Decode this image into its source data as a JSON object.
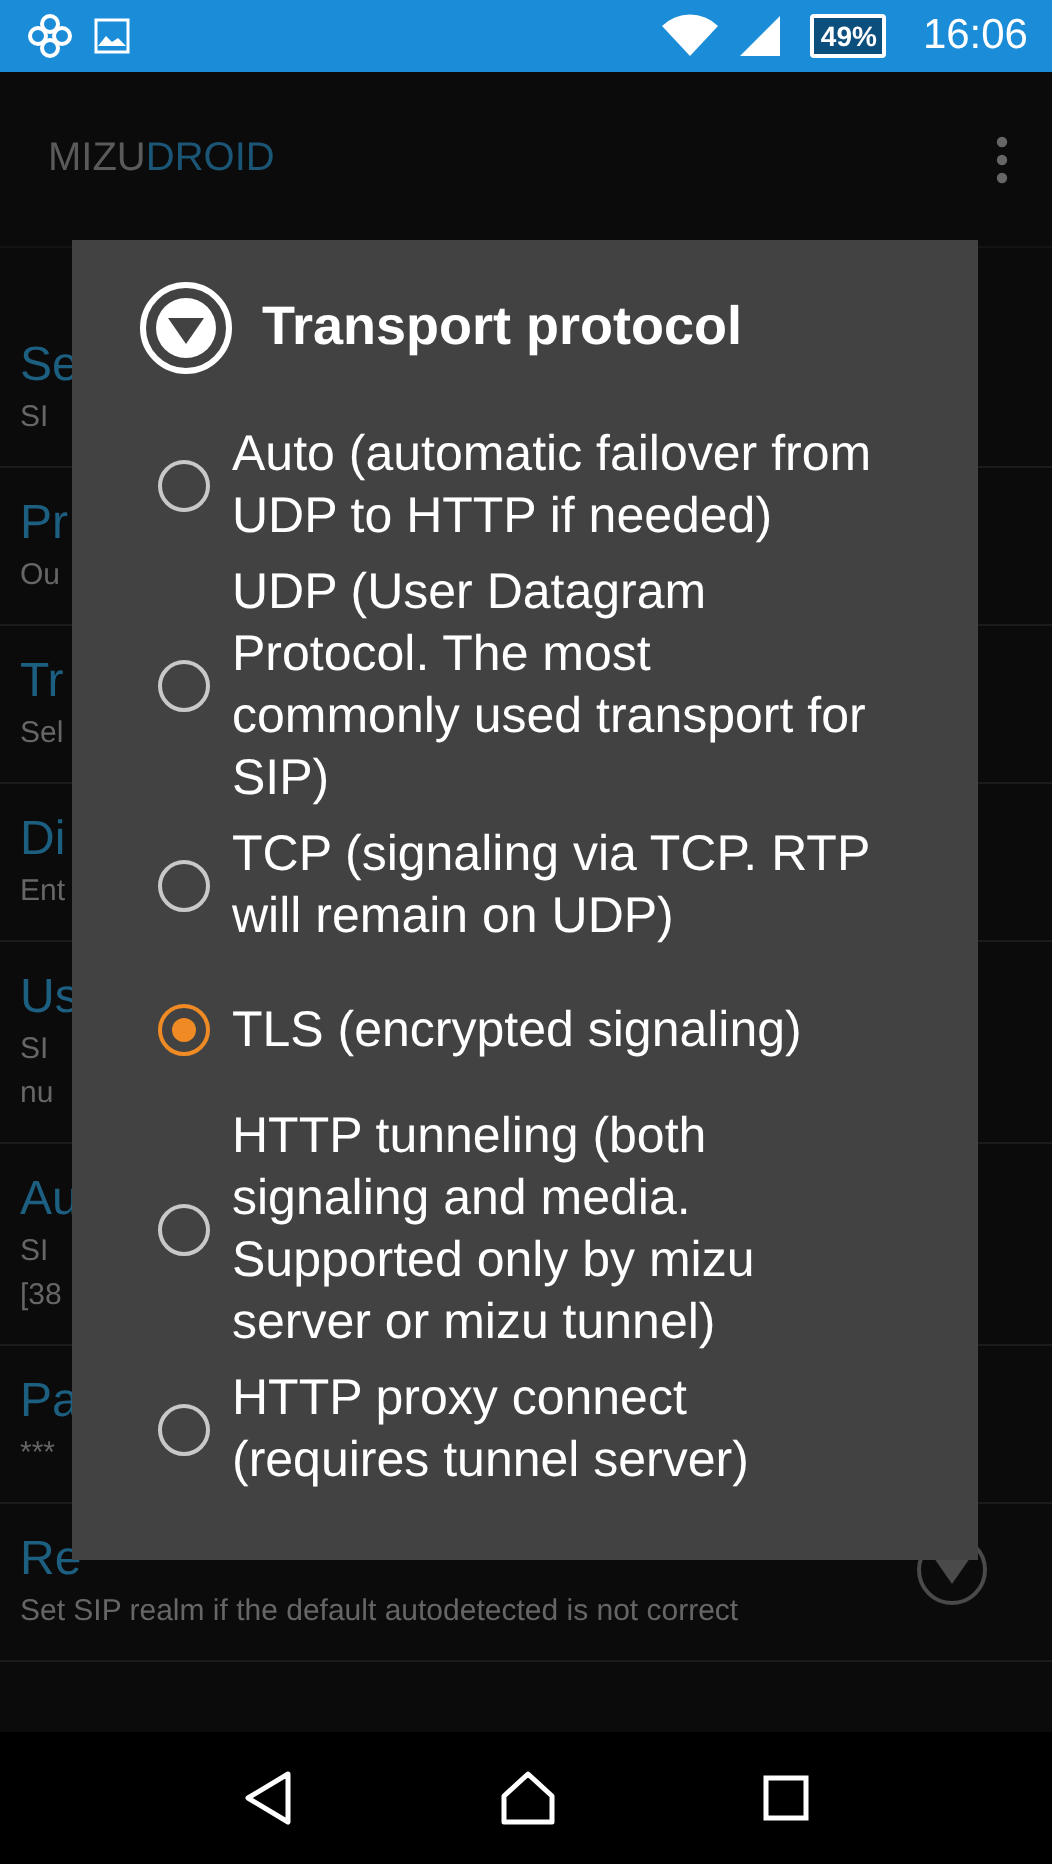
{
  "status_bar": {
    "battery": "49%",
    "time": "16:06"
  },
  "app_bar": {
    "title_part_1": "MIZU",
    "title_part_2": "DROID"
  },
  "settings_list": [
    {
      "title": "Se",
      "subtitle_lines": [
        "SI"
      ]
    },
    {
      "title": "Pr",
      "subtitle_lines": [
        "Ou"
      ]
    },
    {
      "title": "Tr",
      "subtitle_lines": [
        "Sel"
      ]
    },
    {
      "title": "Di",
      "subtitle_lines": [
        "Ent"
      ]
    },
    {
      "title": "Us",
      "subtitle_lines": [
        "SI",
        "nu"
      ]
    },
    {
      "title": "Au",
      "subtitle_lines": [
        "SI",
        "[38"
      ]
    },
    {
      "title": "Pa",
      "subtitle_lines": [
        "***"
      ]
    },
    {
      "title": "Re",
      "subtitle_lines": [
        "Set SIP realm if the default autodetected is not correct"
      ],
      "dropdown": true
    }
  ],
  "dialog": {
    "title": "Transport protocol",
    "options": [
      {
        "label": "Auto (automatic failover from UDP to HTTP if needed)",
        "selected": false
      },
      {
        "label": "UDP (User Datagram Protocol. The most commonly used transport for SIP)",
        "selected": false
      },
      {
        "label": "TCP (signaling via TCP. RTP will remain on UDP)",
        "selected": false
      },
      {
        "label": "TLS (encrypted signaling)",
        "selected": true
      },
      {
        "label": "HTTP tunneling (both signaling and media. Supported only by mizu server or mizu tunnel)",
        "selected": false
      },
      {
        "label": "HTTP proxy connect (requires tunnel server)",
        "selected": false
      }
    ]
  }
}
